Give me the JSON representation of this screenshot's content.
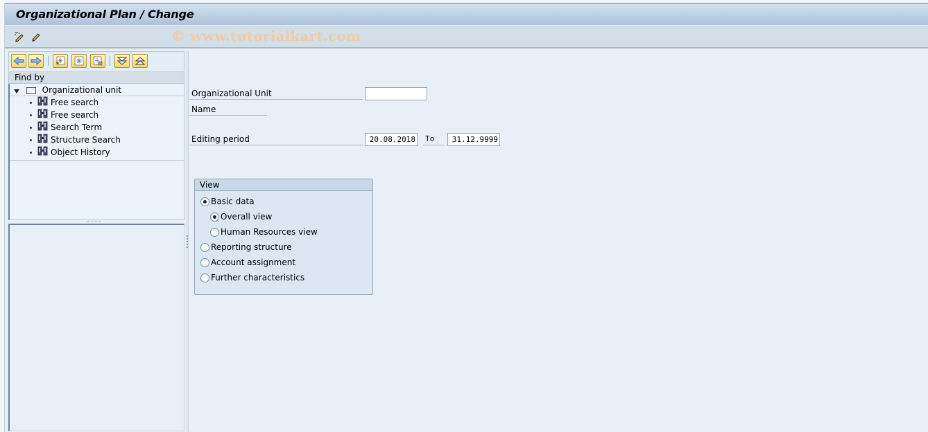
{
  "window": {
    "title": "Organizational Plan / Change",
    "watermark": "© www.tutorialkart.com"
  },
  "toolbar": {
    "buttons": [
      {
        "icon": "magic-pencil-icon",
        "tooltip": ""
      },
      {
        "icon": "pencil-icon",
        "tooltip": ""
      }
    ]
  },
  "navigator": {
    "buttons": [
      {
        "icon": "back-arrow-icon"
      },
      {
        "icon": "forward-arrow-icon"
      },
      {
        "icon": "create-icon"
      },
      {
        "icon": "select-all-icon"
      },
      {
        "icon": "delete-icon"
      },
      {
        "icon": "expand-icon"
      },
      {
        "icon": "collapse-icon"
      }
    ],
    "find_by_label": "Find by",
    "root": {
      "label": "Organizational unit",
      "expanded": true
    },
    "items": [
      {
        "label": "Free search"
      },
      {
        "label": "Free search"
      },
      {
        "label": "Search Term"
      },
      {
        "label": "Structure Search"
      },
      {
        "label": "Object History"
      }
    ]
  },
  "form": {
    "org_unit_label": "Organizational Unit",
    "org_unit_value": "",
    "name_label": "Name",
    "editing_period_label": "Editing period",
    "period_from": "20.08.2018",
    "to_label": "To",
    "period_to": "31.12.9999"
  },
  "view_group": {
    "title": "View",
    "options": [
      {
        "label": "Basic data",
        "selected": true,
        "level": 0
      },
      {
        "label": "Overall view",
        "selected": true,
        "level": 1
      },
      {
        "label": "Human Resources view",
        "selected": false,
        "level": 1
      },
      {
        "label": "Reporting structure",
        "selected": false,
        "level": 0
      },
      {
        "label": "Account assignment",
        "selected": false,
        "level": 0
      },
      {
        "label": "Further characteristics",
        "selected": false,
        "level": 0
      }
    ]
  }
}
